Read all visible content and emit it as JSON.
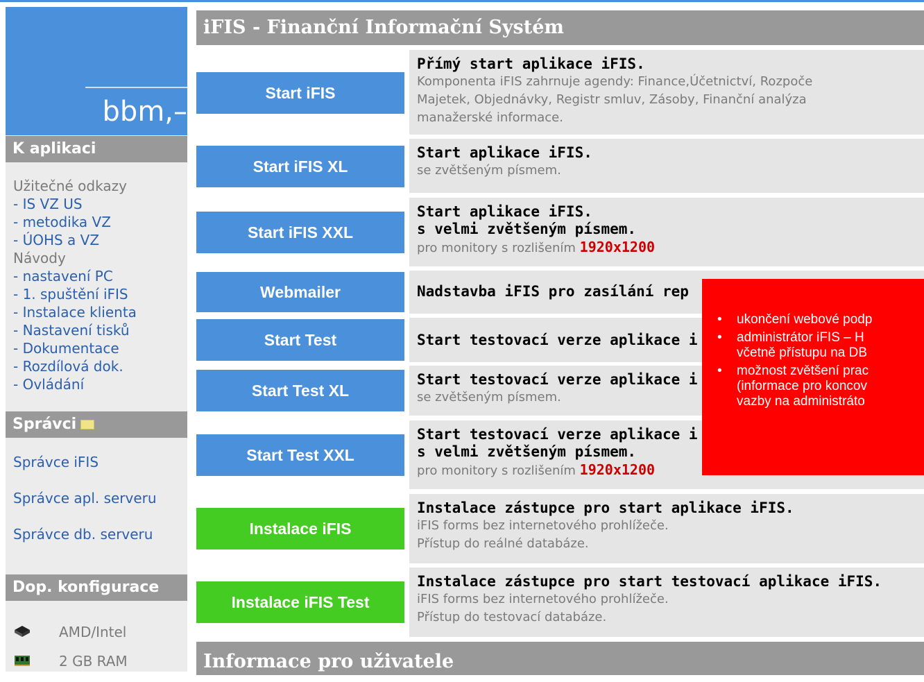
{
  "sidebar": {
    "logo_text": "bbm,–",
    "section1_title": "K aplikaci",
    "links_heading": "Užitečné odkazy",
    "links": [
      "- IS VZ US",
      "- metodika VZ",
      "- ÚOHS a VZ"
    ],
    "guides_heading": "Návody",
    "guides": [
      "- nastavení PC",
      "- 1. spuštění iFIS",
      "- Instalace klienta",
      "- Nastavení tisků",
      "- Dokumentace",
      "- Rozdílová dok.",
      "- Ovládání"
    ],
    "section2_title": "Správci",
    "admins": [
      "Správce iFIS",
      "Správce apl. serveru",
      "Správce db. serveru"
    ],
    "section3_title": "Dop. konfigurace",
    "config": [
      {
        "icon": "cpu-icon",
        "text": "AMD/Intel"
      },
      {
        "icon": "ram-icon",
        "text": "2 GB RAM"
      }
    ]
  },
  "main": {
    "title": "iFIS - Finanční Informační Systém",
    "rows": [
      {
        "button": "Start iFIS",
        "color": "blue",
        "title": "Přímý start aplikace iFIS.",
        "lines": [
          "Komponenta iFIS zahrnuje agendy: Finance,Účetnictví, Rozpoče",
          "Majetek, Objednávky, Registr smluv, Zásoby, Finanční analýza",
          "manažerské informace."
        ]
      },
      {
        "button": "Start iFIS XL",
        "color": "blue",
        "title": "Start aplikace iFIS.",
        "lines": [
          "se zvětšeným písmem."
        ]
      },
      {
        "button": "Start iFIS XXL",
        "color": "blue",
        "title": "Start aplikace iFIS.",
        "title2": "s velmi zvětšeným písmem.",
        "res_prefix": "pro monitory s rozlišením ",
        "res_value": "1920x1200"
      },
      {
        "button": "Webmailer",
        "color": "blue",
        "title": "Nadstavba iFIS pro zasílání rep"
      },
      {
        "button": "Start Test",
        "color": "blue",
        "title": "Start testovací verze aplikace i"
      },
      {
        "button": "Start Test XL",
        "color": "blue",
        "title": "Start testovací verze aplikace i",
        "lines": [
          "se zvětšeným písmem."
        ]
      },
      {
        "button": "Start Test XXL",
        "color": "blue",
        "title": "Start testovací verze aplikace i",
        "title2": "s velmi zvětšeným písmem.",
        "res_prefix": "pro monitory s rozlišením ",
        "res_value": "1920x1200"
      },
      {
        "button": "Instalace iFIS",
        "color": "green",
        "title": "Instalace zástupce pro start aplikace iFIS.",
        "lines": [
          "iFIS forms bez internetového prohlížeče.",
          "Přístup do reálné databáze."
        ]
      },
      {
        "button": "Instalace iFIS Test",
        "color": "green",
        "title": "Instalace zástupce pro start testovací aplikace iFIS.",
        "lines": [
          "iFIS forms bez internetového prohlížeče.",
          "Přístup do testovací databáze."
        ]
      }
    ],
    "bottom_title": "Informace pro uživatele"
  },
  "overlay": {
    "bullet": "•",
    "items": [
      "ukončení webové podp",
      "administrátor iFIS – H",
      "včetně přístupu na DB",
      "možnost zvětšení prac",
      "(informace pro koncov",
      "vazby na administráto"
    ]
  },
  "colors": {
    "accent_blue": "#4b90da",
    "install_green": "#44cc22",
    "overlay_red": "#ff0000",
    "header_gray": "#999999"
  }
}
